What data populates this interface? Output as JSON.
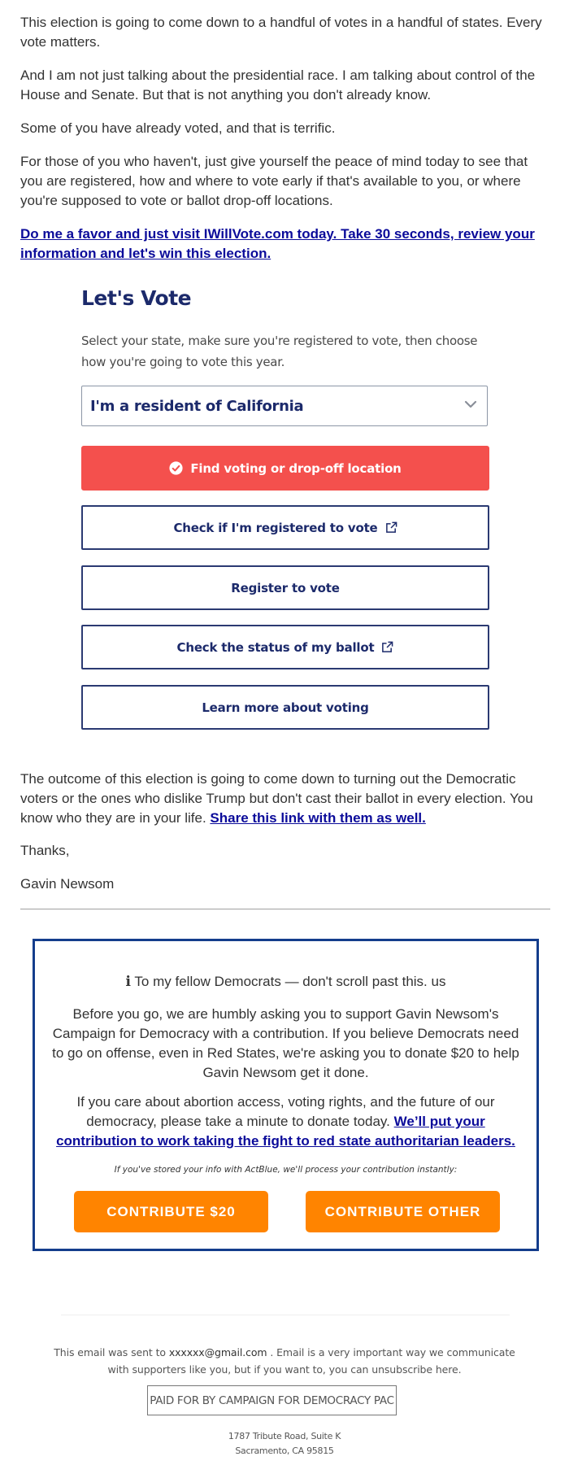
{
  "email_body": {
    "paragraphs": [
      "This election is going to come down to a handful of votes in a handful of states. Every vote matters.",
      "And I am not just talking about the presidential race. I am talking about control of the House and Senate. But that is not anything you don't already know.",
      "Some of you have already voted, and that is terrific.",
      "For those of you who haven't, just give yourself the peace of mind today to see that you are registered, how and where to vote early if that's available to you, or where you're supposed to vote or ballot drop-off locations."
    ],
    "cta_link": "Do me a favor and just visit IWillVote.com today. Take 30 seconds, review your information and let's win this election.",
    "outcome_text": "The outcome of this election is going to come down to turning out the Democratic voters or the ones who dislike Trump but don't cast their ballot in every election. You know who they are in your life.",
    "share_link": "Share this link with them as well.",
    "signoff": "Thanks,",
    "signature": "Gavin Newsom"
  },
  "vote_card": {
    "title": "Let's Vote",
    "description": "Select your state, make sure you're registered to vote, then choose how you're going to vote this year.",
    "state_select": {
      "value": "I'm a resident of California",
      "icon": "chevron-down-icon"
    },
    "buttons": [
      {
        "label": "Find voting or drop-off location",
        "icon": "check-circle-icon",
        "style": "primary",
        "color": "#f4504d"
      },
      {
        "label": "Check if I'm registered to vote",
        "icon": "external-link-icon"
      },
      {
        "label": "Register to vote"
      },
      {
        "label": "Check the status of my ballot",
        "icon": "external-link-icon"
      },
      {
        "label": "Learn more about voting"
      }
    ],
    "text_color": "#1c2a6b"
  },
  "donation": {
    "border_color": "#143d8c",
    "intro_icon": "info-icon",
    "intro_glyph": "i",
    "intro": "To my fellow Democrats — don't scroll past this. us",
    "paragraph1": "Before you go, we are humbly asking you to support Gavin Newsom's Campaign for Democracy with a contribution. If you believe Democrats need to go on offense, even in Red States, we're asking you to donate $20 to help Gavin Newsom get it done.",
    "paragraph2_text": "If you care about abortion access, voting rights, and the future of our democracy, please take a minute to donate today.",
    "paragraph2_link": "We’ll put your contribution to work taking the fight to red state authoritarian leaders.",
    "note": "If you've stored your info with ActBlue, we'll process your contribution instantly:",
    "buttons": [
      {
        "label": "CONTRIBUTE $20"
      },
      {
        "label": "CONTRIBUTE OTHER"
      }
    ],
    "button_color": "#ff8400"
  },
  "footer": {
    "sent_prefix": "This email was sent to",
    "email": "xxxxxx@gmail.com",
    "sent_suffix": ". Email is a very important way we communicate with supporters like you, but if you want to, you can unsubscribe here.",
    "paid_for": "PAID FOR BY CAMPAIGN FOR DEMOCRACY PAC",
    "address_line1": "1787 Tribute Road, Suite K",
    "address_line2": "Sacramento, CA 95815"
  }
}
